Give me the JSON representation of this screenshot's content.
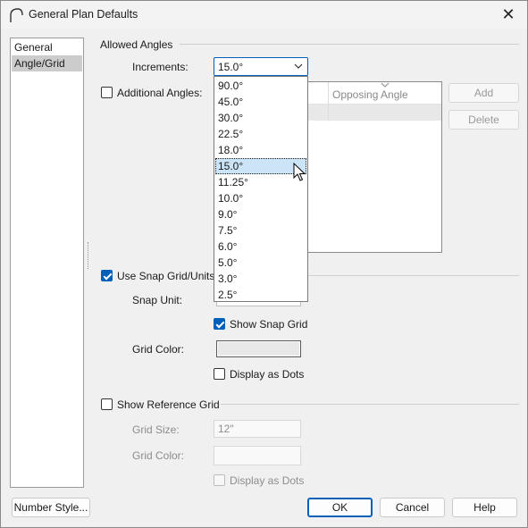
{
  "window": {
    "title": "General Plan Defaults",
    "close_glyph": "✕"
  },
  "tree": {
    "items": [
      {
        "label": "General",
        "selected": false
      },
      {
        "label": "Angle/Grid",
        "selected": true
      }
    ]
  },
  "allowed_angles": {
    "group_label": "Allowed Angles",
    "increments_label": "Increments:",
    "increments_value": "15.0°",
    "dropdown_options": [
      "90.0°",
      "45.0°",
      "30.0°",
      "22.5°",
      "18.0°",
      "15.0°",
      "11.25°",
      "10.0°",
      "9.0°",
      "7.5°",
      "6.0°",
      "5.0°",
      "3.0°",
      "2.5°"
    ],
    "hovered_option": "15.0°",
    "additional_angles_label": "Additional Angles:",
    "additional_angles_checked": false,
    "list_header": "Opposing Angle",
    "add_label": "Add",
    "delete_label": "Delete"
  },
  "snap_grid": {
    "group_label": "Use Snap Grid/Units",
    "checked": true,
    "snap_unit_label": "Snap Unit:",
    "show_snap_grid_label": "Show Snap Grid",
    "show_snap_grid_checked": true,
    "grid_color_label": "Grid Color:",
    "grid_color": "#e8e8e8",
    "display_dots_label": "Display as Dots",
    "display_dots_checked": false
  },
  "reference_grid": {
    "group_label": "Show Reference Grid",
    "checked": false,
    "grid_size_label": "Grid Size:",
    "grid_size_value": "12\"",
    "grid_color_label": "Grid Color:",
    "display_dots_label": "Display as Dots",
    "display_dots_checked": false
  },
  "footer": {
    "number_style_label": "Number Style...",
    "ok_label": "OK",
    "cancel_label": "Cancel",
    "help_label": "Help"
  },
  "colors": {
    "accent": "#005fb8",
    "hover": "#cce4f7",
    "selected_tree": "#cccccc"
  }
}
